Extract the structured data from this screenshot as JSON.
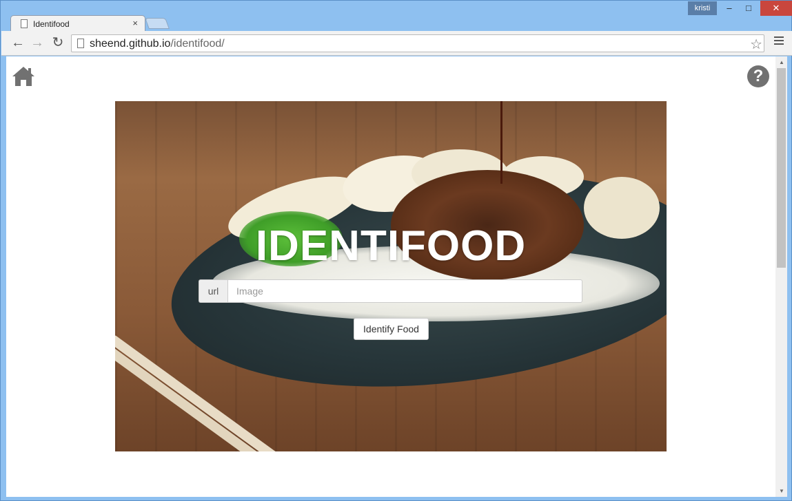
{
  "window": {
    "user": "kristi",
    "controls": {
      "minimize": "‒",
      "maximize": "□",
      "close": "✕"
    }
  },
  "tabs": [
    {
      "title": "Identifood",
      "close": "×"
    }
  ],
  "toolbar": {
    "back": "←",
    "forward": "→",
    "reload": "↻",
    "url_host": "sheend.github.io",
    "url_path": "/identifood/",
    "star": "☆"
  },
  "page": {
    "hero_title": "IDENTIFOOD",
    "input_addon": "url",
    "input_placeholder": "Image",
    "input_value": "",
    "submit_label": "Identify Food",
    "help_glyph": "?"
  },
  "icons": {
    "home": "home-icon",
    "help": "question-circle-icon",
    "favicon": "page-icon"
  },
  "colors": {
    "titlebar": "#8ec0f0",
    "close_button": "#c9463d",
    "help_icon": "#717171"
  }
}
